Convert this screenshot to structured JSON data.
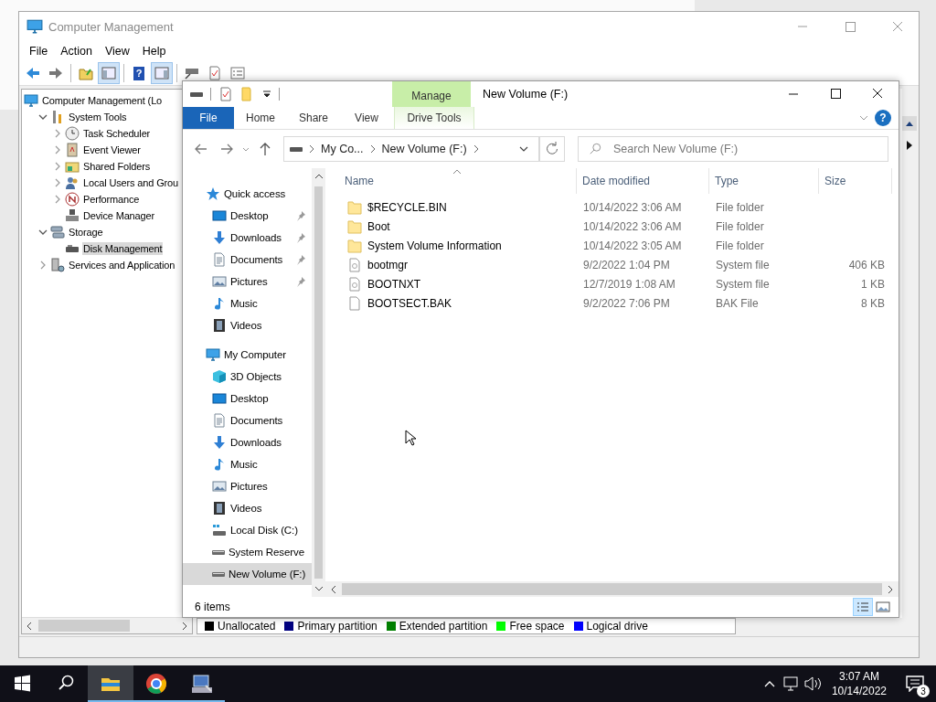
{
  "management_window": {
    "title": "Computer Management",
    "menu": [
      "File",
      "Action",
      "View",
      "Help"
    ],
    "toolbar": [
      {
        "kind": "back"
      },
      {
        "kind": "forward"
      },
      {
        "kind": "sep"
      },
      {
        "kind": "folder-up"
      },
      {
        "kind": "panel",
        "selected": true
      },
      {
        "kind": "sep"
      },
      {
        "kind": "help",
        "label": "?"
      },
      {
        "kind": "panel2",
        "selected": true
      },
      {
        "kind": "sep"
      },
      {
        "kind": "drive"
      },
      {
        "kind": "doc"
      },
      {
        "kind": "list"
      }
    ],
    "tree": [
      {
        "label": "Computer Management (Lo",
        "kind": "computer",
        "selected": false,
        "children": [
          {
            "label": "System Tools",
            "kind": "tools",
            "expanded": true,
            "selected": false,
            "children": [
              {
                "label": "Task Scheduler",
                "kind": "clock",
                "expanded": false,
                "selected": false
              },
              {
                "label": "Event Viewer",
                "kind": "log",
                "expanded": false,
                "selected": false
              },
              {
                "label": "Shared Folders",
                "kind": "share",
                "expanded": false,
                "selected": false
              },
              {
                "label": "Local Users and Grou",
                "kind": "users",
                "expanded": false,
                "selected": false
              },
              {
                "label": "Performance",
                "kind": "performance",
                "expanded": false,
                "selected": false
              },
              {
                "label": "Device Manager",
                "kind": "device",
                "selected": false
              }
            ]
          },
          {
            "label": "Storage",
            "kind": "storage",
            "expanded": true,
            "selected": false,
            "children": [
              {
                "label": "Disk Management",
                "kind": "disk",
                "selected": true
              }
            ]
          },
          {
            "label": "Services and Application",
            "kind": "services",
            "expanded": false,
            "selected": false
          }
        ]
      }
    ],
    "legend": [
      {
        "label": "Unallocated",
        "color": "#000000"
      },
      {
        "label": "Primary partition",
        "color": "#000080"
      },
      {
        "label": "Extended partition",
        "color": "#008000"
      },
      {
        "label": "Free space",
        "color": "#00ff00"
      },
      {
        "label": "Logical drive",
        "color": "#0000ff"
      }
    ]
  },
  "explorer": {
    "context_tab": "Manage",
    "title": "New Volume (F:)",
    "ribbon_tabs": [
      {
        "label": "File",
        "kind": "file"
      },
      {
        "label": "Home",
        "kind": "plain"
      },
      {
        "label": "Share",
        "kind": "plain"
      },
      {
        "label": "View",
        "kind": "plain"
      },
      {
        "label": "Drive Tools",
        "kind": "context"
      }
    ],
    "help": "?",
    "address": [
      "My Co...",
      "New Volume (F:)"
    ],
    "search": {
      "placeholder": "Search New Volume (F:)"
    },
    "navigation": [
      {
        "label": "Quick access",
        "kind": "star",
        "selected": false,
        "children": [
          {
            "label": "Desktop",
            "kind": "desktop",
            "pinned": true,
            "selected": false
          },
          {
            "label": "Downloads",
            "kind": "download",
            "pinned": true,
            "selected": false
          },
          {
            "label": "Documents",
            "kind": "document",
            "pinned": true,
            "selected": false
          },
          {
            "label": "Pictures",
            "kind": "pictures",
            "pinned": true,
            "selected": false
          },
          {
            "label": "Music",
            "kind": "music",
            "pinned": false,
            "selected": false
          },
          {
            "label": "Videos",
            "kind": "videos",
            "pinned": false,
            "selected": false
          }
        ]
      },
      {
        "label": "My Computer",
        "kind": "computer",
        "selected": false,
        "children": [
          {
            "label": "3D Objects",
            "kind": "cube",
            "selected": false
          },
          {
            "label": "Desktop",
            "kind": "desktop",
            "selected": false
          },
          {
            "label": "Documents",
            "kind": "document",
            "selected": false
          },
          {
            "label": "Downloads",
            "kind": "download",
            "selected": false
          },
          {
            "label": "Music",
            "kind": "music",
            "selected": false
          },
          {
            "label": "Pictures",
            "kind": "pictures",
            "selected": false
          },
          {
            "label": "Videos",
            "kind": "videos",
            "selected": false
          },
          {
            "label": "Local Disk (C:)",
            "kind": "localdisk",
            "selected": false
          },
          {
            "label": "System Reserve",
            "kind": "drive",
            "selected": false
          },
          {
            "label": "New Volume (F:)",
            "kind": "drive",
            "selected": true
          }
        ]
      }
    ],
    "columns": [
      "Name",
      "Date modified",
      "Type",
      "Size"
    ],
    "rows": [
      {
        "name": "$RECYCLE.BIN",
        "date": "10/14/2022 3:06 AM",
        "type": "File folder",
        "kind": "folder"
      },
      {
        "name": "Boot",
        "date": "10/14/2022 3:06 AM",
        "type": "File folder",
        "kind": "folder"
      },
      {
        "name": "System Volume Information",
        "date": "10/14/2022 3:05 AM",
        "type": "File folder",
        "kind": "folder"
      },
      {
        "name": "bootmgr",
        "date": "9/2/2022 1:04 PM",
        "type": "System file",
        "size": "406 KB",
        "kind": "sysfile"
      },
      {
        "name": "BOOTNXT",
        "date": "12/7/2019 1:08 AM",
        "type": "System file",
        "size": "1 KB",
        "kind": "sysfile"
      },
      {
        "name": "BOOTSECT.BAK",
        "date": "9/2/2022 7:06 PM",
        "type": "BAK File",
        "size": "8 KB",
        "kind": "file"
      }
    ],
    "status": "6 items"
  },
  "taskbar": {
    "apps": [
      {
        "kind": "explorer",
        "selected": true
      },
      {
        "kind": "chrome",
        "selected": false
      },
      {
        "kind": "management",
        "selected": false
      }
    ],
    "time": "3:07 AM",
    "date": "10/14/2022",
    "notifications": "3"
  }
}
